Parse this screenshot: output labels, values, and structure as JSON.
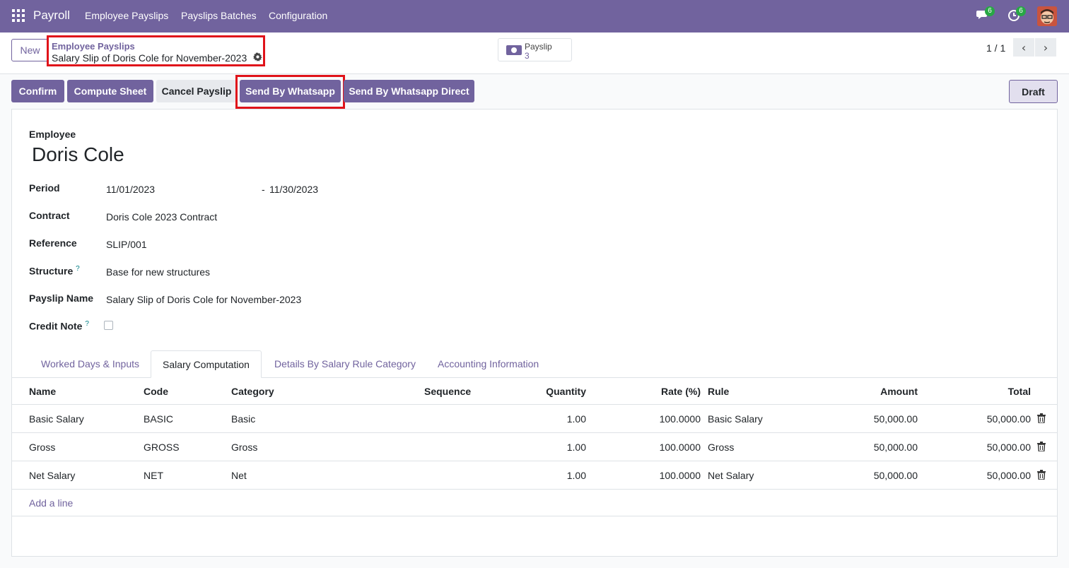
{
  "navbar": {
    "brand": "Payroll",
    "menu": [
      "Employee Payslips",
      "Payslips Batches",
      "Configuration"
    ],
    "messages_count": "6",
    "activities_count": "6"
  },
  "control": {
    "new_label": "New",
    "breadcrumb_parent": "Employee Payslips",
    "breadcrumb_current": "Salary Slip of Doris Cole for November-2023",
    "smart_button_label": "Payslip",
    "smart_button_value": "3",
    "pager": "1 / 1"
  },
  "actions": {
    "confirm": "Confirm",
    "compute_sheet": "Compute Sheet",
    "cancel_payslip": "Cancel Payslip",
    "send_whatsapp": "Send By Whatsapp",
    "send_whatsapp_direct": "Send By Whatsapp Direct",
    "status": "Draft"
  },
  "form": {
    "employee_label": "Employee",
    "employee_name": "Doris Cole",
    "period_label": "Period",
    "period_from": "11/01/2023",
    "period_sep": "-",
    "period_to": "11/30/2023",
    "contract_label": "Contract",
    "contract": "Doris Cole 2023 Contract",
    "reference_label": "Reference",
    "reference": "SLIP/001",
    "structure_label": "Structure",
    "structure": "Base for new structures",
    "payslip_name_label": "Payslip Name",
    "payslip_name": "Salary Slip of Doris Cole for November-2023",
    "credit_note_label": "Credit Note",
    "help_mark": "?"
  },
  "tabs": [
    "Worked Days & Inputs",
    "Salary Computation",
    "Details By Salary Rule Category",
    "Accounting Information"
  ],
  "table": {
    "headers": [
      "Name",
      "Code",
      "Category",
      "Sequence",
      "Quantity",
      "Rate (%)",
      "Rule",
      "Amount",
      "Total"
    ],
    "rows": [
      {
        "name": "Basic Salary",
        "code": "BASIC",
        "category": "Basic",
        "quantity": "1.00",
        "rate": "100.0000",
        "rule": "Basic Salary",
        "amount": "50,000.00",
        "total": "50,000.00"
      },
      {
        "name": "Gross",
        "code": "GROSS",
        "category": "Gross",
        "quantity": "1.00",
        "rate": "100.0000",
        "rule": "Gross",
        "amount": "50,000.00",
        "total": "50,000.00"
      },
      {
        "name": "Net Salary",
        "code": "NET",
        "category": "Net",
        "quantity": "1.00",
        "rate": "100.0000",
        "rule": "Net Salary",
        "amount": "50,000.00",
        "total": "50,000.00"
      }
    ],
    "add_line": "Add a line"
  },
  "colors": {
    "brand": "#71639e",
    "highlight": "#e0131a",
    "badge": "#28a745"
  }
}
